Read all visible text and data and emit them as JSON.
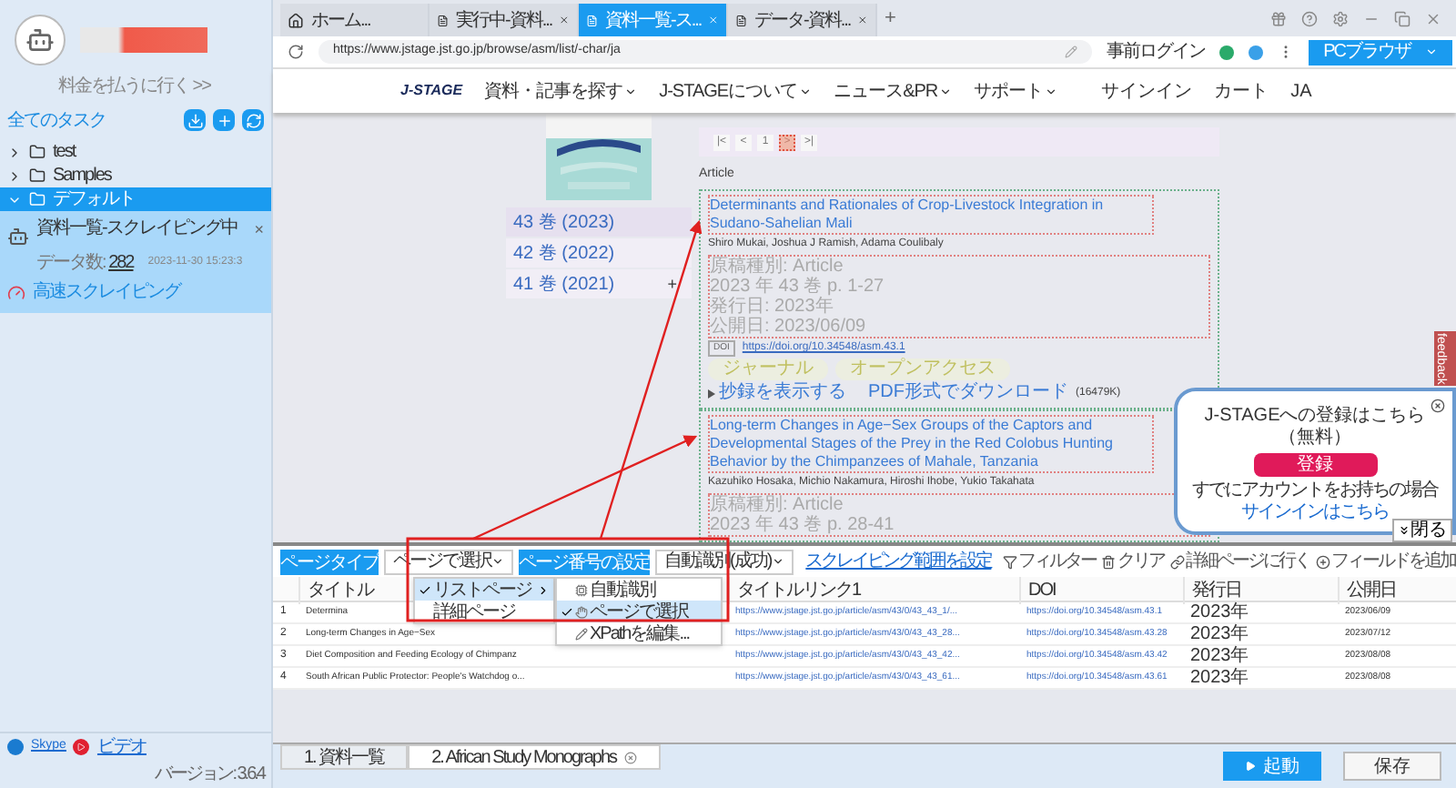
{
  "sidebar": {
    "billing_link": "料金を払うに行く >>",
    "tasks_heading": "全てのタスク",
    "folders": [
      {
        "name": "test",
        "expanded": false,
        "selected": false
      },
      {
        "name": "Samples",
        "expanded": false,
        "selected": false
      },
      {
        "name": "デフォルト",
        "expanded": true,
        "selected": true
      }
    ],
    "task": {
      "title": "資料一覧-スクレイピング中",
      "data_count_label": "データ数:",
      "data_count": "282",
      "time": "2023-11-30 15:23:3",
      "mode": "高速スクレイピング",
      "close": "×"
    },
    "footer": {
      "links": [
        "Skype",
        "ビデオ"
      ],
      "version": "バージョン: 3.6.4"
    }
  },
  "browser": {
    "tabs": [
      {
        "label": "ホーム...",
        "kind": "home",
        "selected": false
      },
      {
        "label": "実行中-資料...",
        "kind": "page",
        "selected": false
      },
      {
        "label": "資料一覧-ス...",
        "kind": "page",
        "selected": true
      },
      {
        "label": "データ-資料...",
        "kind": "page",
        "selected": false
      }
    ],
    "new_tab": "+",
    "url": "https://www.jstage.jst.go.jp/browse/asm/list/-char/ja",
    "prelogin": "事前ログイン",
    "browser_mode": "PCブラウザ"
  },
  "site": {
    "logo": "J-STAGE",
    "nav": [
      "資料・記事を探す",
      "J-STAGEについて",
      "ニュース&PR",
      "サポート"
    ],
    "right_nav": [
      "サインイン",
      "カート",
      "JA"
    ],
    "volumes": [
      {
        "label": "43 巻 (2023)",
        "selected": true
      },
      {
        "label": "42 巻 (2022)",
        "selected": false
      },
      {
        "label": "41 巻 (2021)",
        "selected": false,
        "toggle": "+"
      }
    ],
    "pagination": [
      {
        "label": "|<",
        "highlighted": false
      },
      {
        "label": "<",
        "highlighted": false
      },
      {
        "label": "1",
        "highlighted": false
      },
      {
        "label": ">",
        "highlighted": true
      },
      {
        "label": ">|",
        "highlighted": false
      }
    ],
    "section_label": "Article",
    "articles": [
      {
        "title": "Determinants and Rationales of Crop-Livestock Integration in Sudano-Sahelian Mali",
        "authors": "Shiro Mukai, Joshua J Ramish, Adama Coulibaly",
        "meta": [
          "原稿種別: Article",
          "2023 年 43 巻 p. 1-27",
          "発行日: 2023年",
          "公開日: 2023/06/09"
        ],
        "doi_badge": "DOI",
        "doi": "https://doi.org/10.34548/asm.43.1",
        "tags": [
          "ジャーナル",
          "オープンアクセス"
        ],
        "abstract_toggle": "抄録を表示する",
        "pdf_link": "PDF形式でダウンロード",
        "pdf_size": "(16479K)"
      },
      {
        "title": "Long-term Changes in Age−Sex Groups of the Captors and Developmental Stages of the Prey in the Red Colobus Hunting Behavior by the Chimpanzees of Mahale, Tanzania",
        "authors": "Kazuhiko Hosaka, Michio Nakamura, Hiroshi Ihobe, Yukio Takahata",
        "meta": [
          "原稿種別: Article",
          "2023 年 43 巻 p. 28-41"
        ]
      }
    ],
    "signup_popup": {
      "title": "J-STAGEへの登録はこちら（無料）",
      "button": "登録",
      "note": "すでにアカウントをお持ちの場合",
      "signin_link": "サインインはこちら"
    },
    "close_button": "閉る",
    "feedback": "feedback"
  },
  "scraper": {
    "toolbar": {
      "page_type_label": "ページタイプ",
      "page_type_value": "ページで選択",
      "page_number_button": "ページ番号の設定",
      "page_number_value": "自動識別(成功)",
      "range_link": "スクレイピング範囲を設定",
      "actions": [
        {
          "label": "フィルター",
          "kind": "filter"
        },
        {
          "label": "クリア",
          "kind": "trash"
        },
        {
          "label": "詳細ページに行く",
          "kind": "link"
        },
        {
          "label": "フィールドを追加",
          "kind": "add"
        }
      ]
    },
    "table": {
      "columns": [
        "タイトル",
        "タイトルリンク1",
        "DOI",
        "発行日",
        "公開日"
      ],
      "rows": [
        {
          "index": "1",
          "cells": [
            "Determina",
            "https://www.jstage.jst.go.jp/article/asm/43/0/43_43_1/...",
            "https://doi.org/10.34548/asm.43.1",
            "2023年",
            "2023/06/09"
          ]
        },
        {
          "index": "2",
          "cells": [
            "Long-term Changes in Age−Sex",
            "https://www.jstage.jst.go.jp/article/asm/43/0/43_43_28...",
            "https://doi.org/10.34548/asm.43.28",
            "2023年",
            "2023/07/12"
          ]
        },
        {
          "index": "3",
          "cells": [
            "Diet Composition and Feeding Ecology of Chimpanz",
            "https://www.jstage.jst.go.jp/article/asm/43/0/43_43_42...",
            "https://doi.org/10.34548/asm.43.42",
            "2023年",
            "2023/08/08"
          ]
        },
        {
          "index": "4",
          "cells": [
            "South African Public Protector: People's Watchdog o...",
            "https://www.jstage.jst.go.jp/article/asm/43/0/43_43_61...",
            "https://doi.org/10.34548/asm.43.61",
            "2023年",
            "2023/08/08"
          ]
        }
      ]
    },
    "page_type_menu": [
      {
        "label": "リストページ",
        "checked": true,
        "submenu": true
      },
      {
        "label": "詳細ページ",
        "checked": false,
        "submenu": false
      }
    ],
    "selection_submenu": [
      {
        "label": "自動識別",
        "checked": false,
        "kind": "auto"
      },
      {
        "label": "ページで選択",
        "checked": true,
        "kind": "hand"
      },
      {
        "label": "XPathを編集...",
        "checked": false,
        "kind": "edit"
      }
    ],
    "tabs": [
      {
        "label": "1. 資料一覧",
        "selected": false,
        "closable": false
      },
      {
        "label": "2. African Study Monographs",
        "selected": true,
        "closable": true
      }
    ],
    "run_button": "起動",
    "save_button": "保存"
  }
}
